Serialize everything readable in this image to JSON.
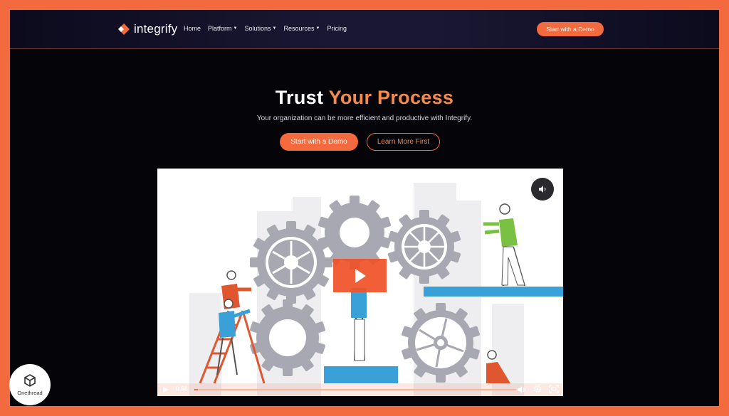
{
  "nav": {
    "logo_text": "integrify",
    "links": [
      {
        "label": "Home",
        "dropdown": false
      },
      {
        "label": "Platform",
        "dropdown": true
      },
      {
        "label": "Solutions",
        "dropdown": true
      },
      {
        "label": "Resources",
        "dropdown": true
      },
      {
        "label": "Pricing",
        "dropdown": false
      }
    ],
    "cta": "Start with a Demo"
  },
  "hero": {
    "title_plain": "Trust ",
    "title_accent": "Your Process",
    "subtitle": "Your organization can be more efficient and productive with Integrify.",
    "primary_button": "Start with a Demo",
    "secondary_button": "Learn More First"
  },
  "video": {
    "time": "0:58",
    "progress": 0.01,
    "icons": [
      "mute-icon",
      "play-icon",
      "volume-icon",
      "settings-icon",
      "fullscreen-icon"
    ]
  },
  "badge": {
    "text": "Onethread"
  },
  "colors": {
    "accent": "#f26a3d",
    "frame": "#f26a3d",
    "background": "#050409",
    "gear_gray": "#a8a8b2",
    "figure_blue": "#3aa0d8",
    "figure_green": "#7ac043"
  }
}
